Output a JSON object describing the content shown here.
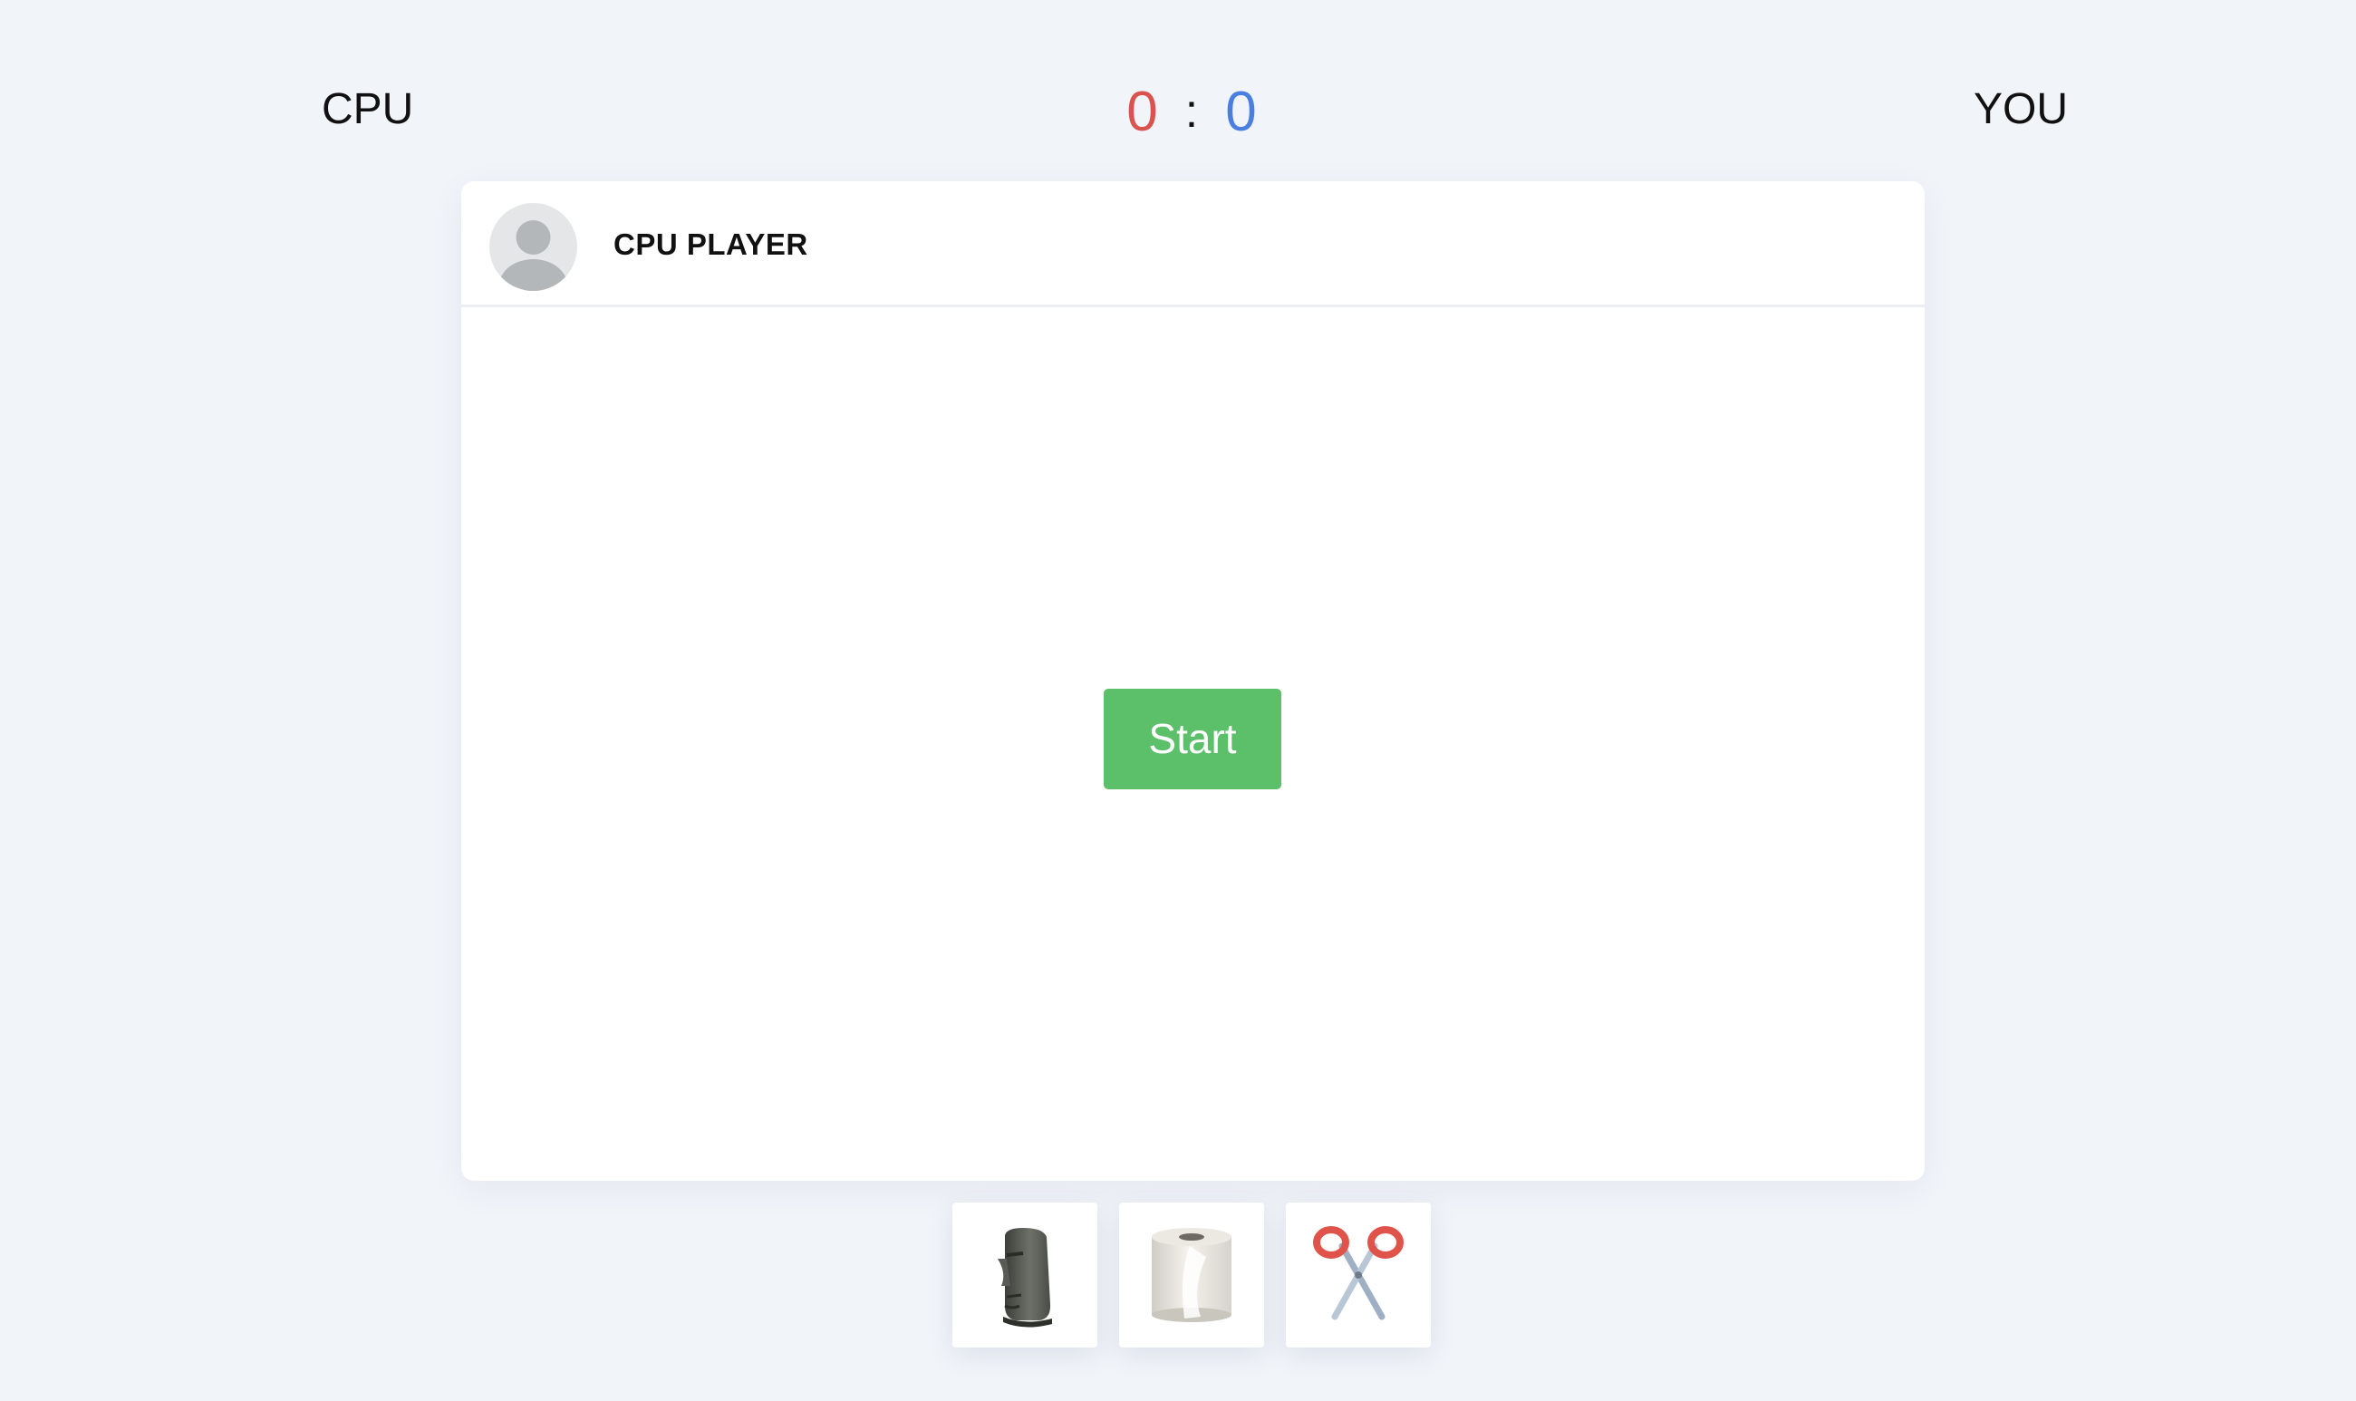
{
  "header": {
    "cpu_label": "CPU",
    "you_label": "YOU"
  },
  "score": {
    "cpu": "0",
    "separator": ":",
    "you": "0",
    "cpu_color": "#d9534f",
    "you_color": "#4a7fe0"
  },
  "board": {
    "player_name": "CPU PLAYER",
    "avatar_icon": "user-silhouette-icon",
    "start_label": "Start",
    "start_color": "#5cbf6a"
  },
  "choices": [
    {
      "name": "rock",
      "icon": "moai-icon"
    },
    {
      "name": "paper",
      "icon": "toilet-paper-icon"
    },
    {
      "name": "scissors",
      "icon": "scissors-icon"
    }
  ]
}
